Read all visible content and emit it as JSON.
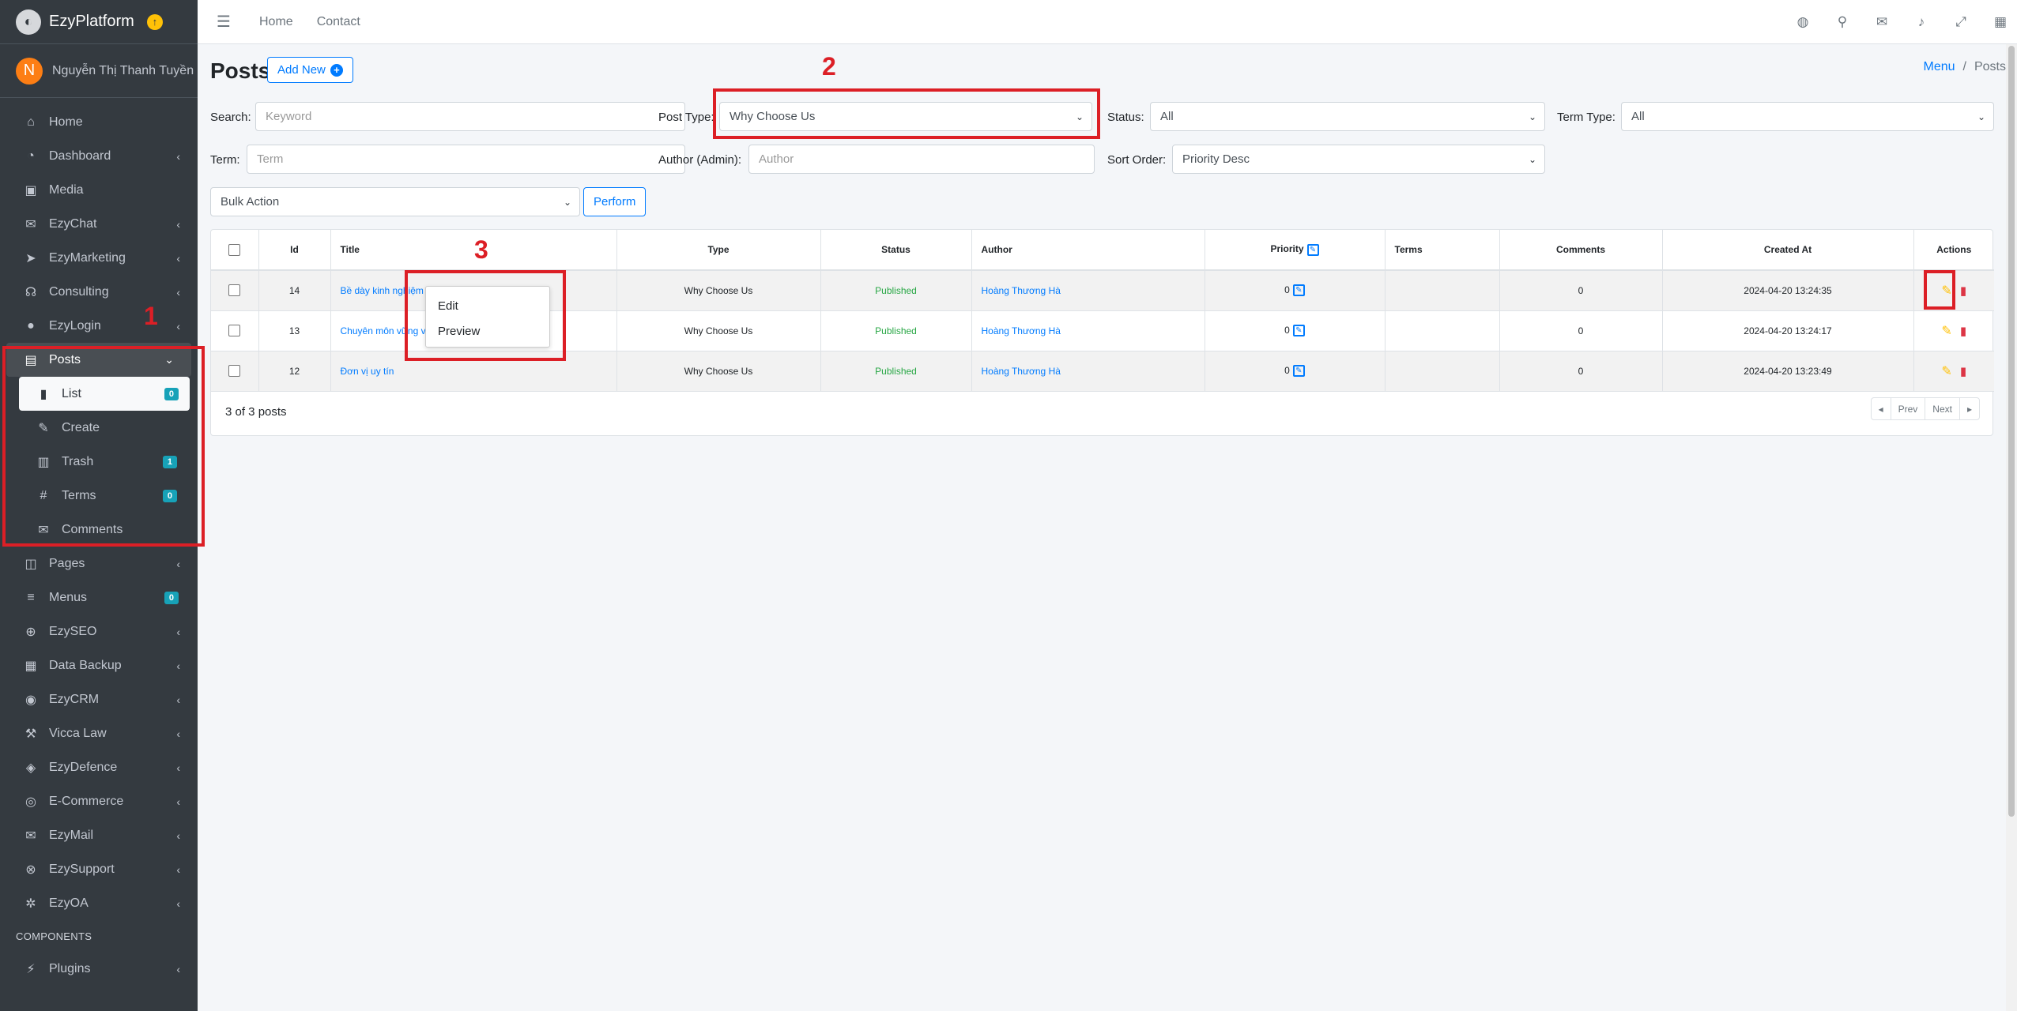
{
  "brand": {
    "name": "EzyPlatform",
    "logo_icon": "platform-logo-icon",
    "upgrade_icon": "arrow-up-circle-icon",
    "upgrade_glyph": "↑"
  },
  "user": {
    "initial": "N",
    "name": "Nguyễn Thị Thanh Tuyền"
  },
  "sidebar": {
    "items": [
      {
        "label": "Home",
        "icon": "home-icon",
        "glyph": "⌂"
      },
      {
        "label": "Dashboard",
        "icon": "dashboard-icon",
        "glyph": "◔"
      },
      {
        "label": "Media",
        "icon": "image-icon",
        "glyph": "▣"
      },
      {
        "label": "EzyChat",
        "icon": "chat-icon",
        "glyph": "✉"
      },
      {
        "label": "EzyMarketing",
        "icon": "megaphone-icon",
        "glyph": "➤"
      },
      {
        "label": "Consulting",
        "icon": "headset-icon",
        "glyph": "☊"
      },
      {
        "label": "EzyLogin",
        "icon": "user-lock-icon",
        "glyph": "●"
      },
      {
        "label": "Posts",
        "icon": "newspaper-icon",
        "glyph": "▤"
      }
    ],
    "posts_sub": [
      {
        "label": "List",
        "icon": "book-icon",
        "glyph": "▮",
        "badge": "0"
      },
      {
        "label": "Create",
        "icon": "edit-icon",
        "glyph": "✎"
      },
      {
        "label": "Trash",
        "icon": "trash-icon",
        "glyph": "▥",
        "badge": "1"
      },
      {
        "label": "Terms",
        "icon": "hashtag-icon",
        "glyph": "#",
        "badge": "0"
      },
      {
        "label": "Comments",
        "icon": "comments-icon",
        "glyph": "✉"
      }
    ],
    "items_after": [
      {
        "label": "Pages",
        "icon": "columns-icon",
        "glyph": "◫"
      },
      {
        "label": "Menus",
        "icon": "bars-icon",
        "glyph": "≡",
        "badge": "0"
      },
      {
        "label": "EzySEO",
        "icon": "search-plus-icon",
        "glyph": "⊕"
      },
      {
        "label": "Data Backup",
        "icon": "box-icon",
        "glyph": "▦"
      },
      {
        "label": "EzyCRM",
        "icon": "handshake-icon",
        "glyph": "◉"
      },
      {
        "label": "Vicca Law",
        "icon": "gavel-icon",
        "glyph": "⚒"
      },
      {
        "label": "EzyDefence",
        "icon": "shield-icon",
        "glyph": "◈"
      },
      {
        "label": "E-Commerce",
        "icon": "shopping-cart-icon",
        "glyph": "◎"
      },
      {
        "label": "EzyMail",
        "icon": "envelope-icon",
        "glyph": "✉"
      },
      {
        "label": "EzySupport",
        "icon": "life-ring-icon",
        "glyph": "⊗"
      },
      {
        "label": "EzyOA",
        "icon": "gear-icon",
        "glyph": "✲"
      }
    ],
    "components_header": "COMPONENTS",
    "plugins": {
      "label": "Plugins",
      "icon": "plug-icon",
      "glyph": "⚡"
    }
  },
  "topbar": {
    "home": "Home",
    "contact": "Contact",
    "icons": [
      "globe-icon",
      "search-icon",
      "comments-icon",
      "bell-icon",
      "expand-icon",
      "grid-icon"
    ]
  },
  "page": {
    "title": "Posts",
    "add_new": "Add New",
    "breadcrumb": {
      "menu": "Menu",
      "sep": "/",
      "current": "Posts"
    }
  },
  "filters": {
    "search_label": "Search:",
    "search_placeholder": "Keyword",
    "post_type_label": "Post Type:",
    "post_type_value": "Why Choose Us",
    "status_label": "Status:",
    "status_value": "All",
    "term_type_label": "Term Type:",
    "term_type_value": "All",
    "term_label": "Term:",
    "term_placeholder": "Term",
    "author_label": "Author (Admin):",
    "author_placeholder": "Author",
    "sort_label": "Sort Order:",
    "sort_value": "Priority Desc",
    "bulk_value": "Bulk Action",
    "perform": "Perform"
  },
  "table": {
    "headers": {
      "id": "Id",
      "title": "Title",
      "type": "Type",
      "status": "Status",
      "author": "Author",
      "priority": "Priority",
      "terms": "Terms",
      "comments": "Comments",
      "created": "Created At",
      "actions": "Actions"
    },
    "rows": [
      {
        "id": "14",
        "title": "Bề dày kinh nghiệm",
        "type": "Why Choose Us",
        "status": "Published",
        "author": "Hoàng Thương Hà",
        "priority": "0",
        "terms": "",
        "comments": "0",
        "created": "2024-04-20 13:24:35"
      },
      {
        "id": "13",
        "title": "Chuyên môn vững vàng",
        "type": "Why Choose Us",
        "status": "Published",
        "author": "Hoàng Thương Hà",
        "priority": "0",
        "terms": "",
        "comments": "0",
        "created": "2024-04-20 13:24:17"
      },
      {
        "id": "12",
        "title": "Đơn vị uy tín",
        "type": "Why Choose Us",
        "status": "Published",
        "author": "Hoàng Thương Hà",
        "priority": "0",
        "terms": "",
        "comments": "0",
        "created": "2024-04-20 13:23:49"
      }
    ],
    "count": "3 of 3 posts",
    "pager": {
      "prev": "Prev",
      "next": "Next"
    }
  },
  "context_menu": {
    "edit": "Edit",
    "preview": "Preview"
  },
  "annotations": {
    "one": "1",
    "two": "2",
    "three": "3",
    "color": "#dc1f26"
  }
}
